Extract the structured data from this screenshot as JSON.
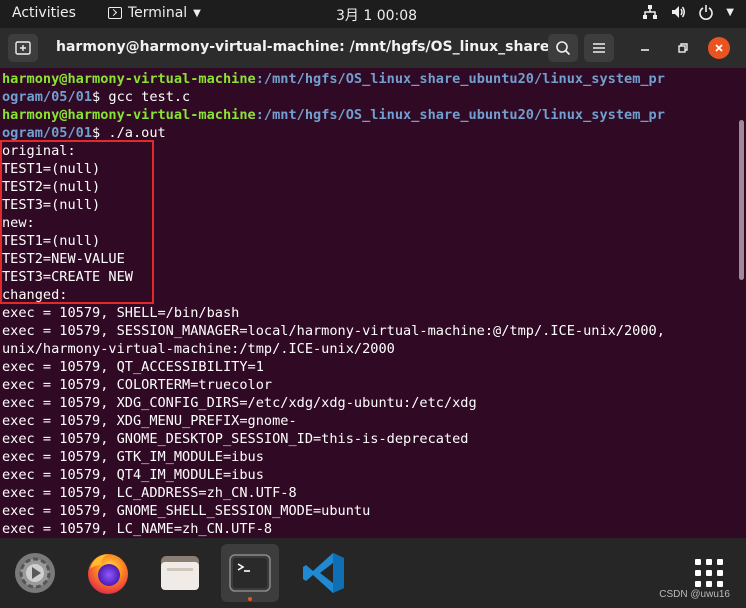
{
  "topbar": {
    "activities": "Activities",
    "app_name": "Terminal",
    "clock": "3月 1  00:08"
  },
  "window": {
    "title": "harmony@harmony-virtual-machine: /mnt/hgfs/OS_linux_share_..."
  },
  "terminal": {
    "prompt_user": "harmony@harmony-virtual-machine",
    "prompt_path_1": ":/mnt/hgfs/OS_linux_share_ubuntu20/linux_system_pr",
    "prompt_path_2": "ogram/05/01",
    "cmd1": "$ gcc test.c",
    "cmd2": "$ ./a.out",
    "output": [
      "original:",
      "TEST1=(null)",
      "TEST2=(null)",
      "TEST3=(null)",
      "new:",
      "TEST1=(null)",
      "TEST2=NEW-VALUE",
      "TEST3=CREATE NEW",
      "changed:",
      "exec = 10579, SHELL=/bin/bash",
      "exec = 10579, SESSION_MANAGER=local/harmony-virtual-machine:@/tmp/.ICE-unix/2000,",
      "unix/harmony-virtual-machine:/tmp/.ICE-unix/2000",
      "exec = 10579, QT_ACCESSIBILITY=1",
      "exec = 10579, COLORTERM=truecolor",
      "exec = 10579, XDG_CONFIG_DIRS=/etc/xdg/xdg-ubuntu:/etc/xdg",
      "exec = 10579, XDG_MENU_PREFIX=gnome-",
      "exec = 10579, GNOME_DESKTOP_SESSION_ID=this-is-deprecated",
      "exec = 10579, GTK_IM_MODULE=ibus",
      "exec = 10579, QT4_IM_MODULE=ibus",
      "exec = 10579, LC_ADDRESS=zh_CN.UTF-8",
      "exec = 10579, GNOME_SHELL_SESSION_MODE=ubuntu",
      "exec = 10579, LC_NAME=zh_CN.UTF-8"
    ]
  },
  "dock": {
    "items": [
      "software-updater-icon",
      "firefox-icon",
      "files-icon",
      "terminal-icon",
      "vscode-icon",
      "show-apps-icon"
    ],
    "watermark": "CSDN @uwu16"
  },
  "colors": {
    "terminal_bg": "#300a24",
    "prompt_user": "#8ae234",
    "prompt_path": "#729fcf",
    "highlight_border": "#e32a2a",
    "accent": "#e95420"
  }
}
